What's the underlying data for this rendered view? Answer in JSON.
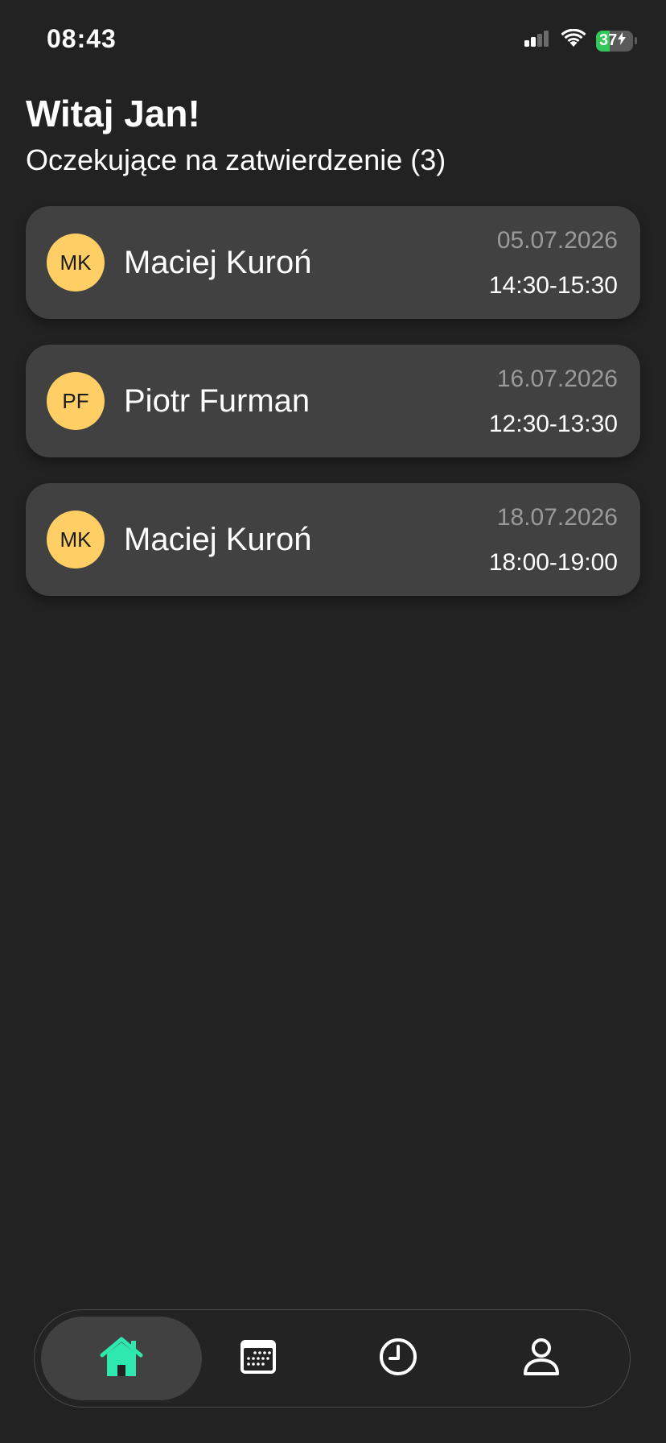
{
  "status_bar": {
    "time": "08:43",
    "battery_level": "37",
    "battery_percent": 37,
    "signal_icon": "cellular-signal-icon",
    "wifi_icon": "wifi-icon",
    "battery_icon": "battery-charging-icon"
  },
  "header": {
    "greeting": "Witaj Jan!",
    "subtitle": "Oczekujące na zatwierdzenie (3)"
  },
  "pending": [
    {
      "initials": "MK",
      "name": "Maciej Kuroń",
      "date": "05.07.2026",
      "time": "14:30-15:30"
    },
    {
      "initials": "PF",
      "name": "Piotr Furman",
      "date": "16.07.2026",
      "time": "12:30-13:30"
    },
    {
      "initials": "MK",
      "name": "Maciej Kuroń",
      "date": "18.07.2026",
      "time": "18:00-19:00"
    }
  ],
  "nav": {
    "items": [
      {
        "icon": "home-icon",
        "active": true
      },
      {
        "icon": "calendar-icon",
        "active": false
      },
      {
        "icon": "clock-icon",
        "active": false
      },
      {
        "icon": "user-icon",
        "active": false
      }
    ]
  },
  "colors": {
    "background": "#222222",
    "card": "#414141",
    "avatar": "#ffcf66",
    "accent": "#2ee8b0",
    "battery": "#34c759"
  }
}
